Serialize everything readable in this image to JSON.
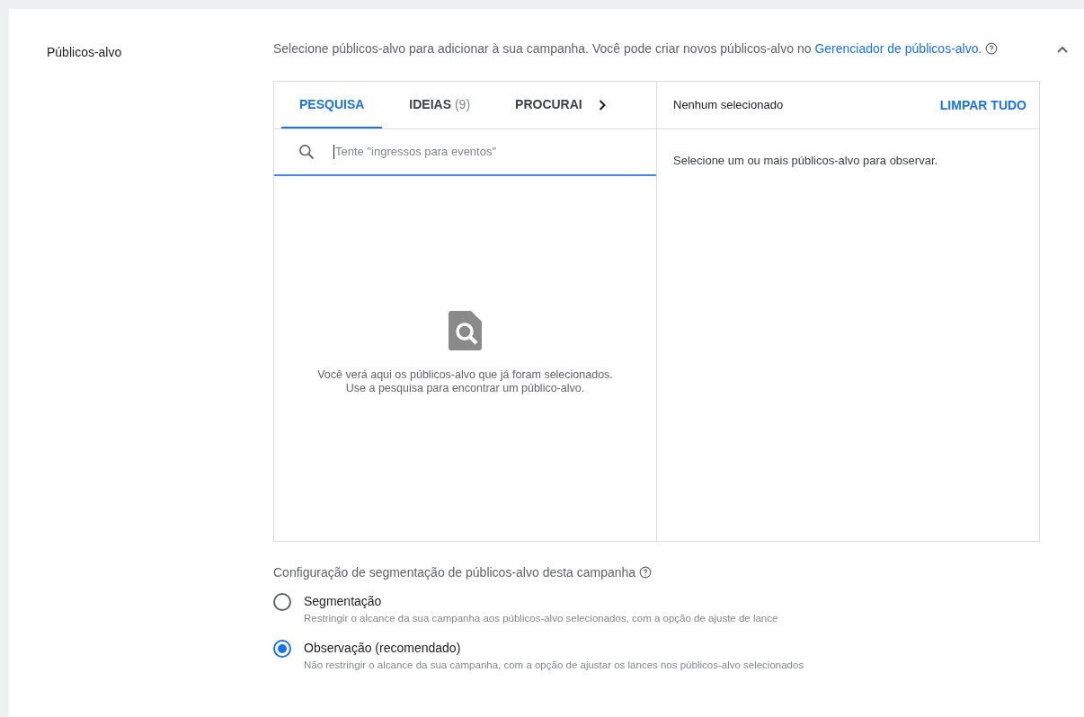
{
  "section": {
    "label": "Públicos-alvo",
    "description": "Selecione públicos-alvo para adicionar à sua campanha. Você pode criar novos públicos-alvo no",
    "link": "Gerenciador de públicos-alvo",
    "link_suffix": ".",
    "expanded": true
  },
  "tabs": [
    {
      "label": "PESQUISA",
      "selected": true
    },
    {
      "label": "IDEIAS",
      "count": "(9)",
      "selected": false
    },
    {
      "label": "PROCURAI",
      "selected": false
    }
  ],
  "search": {
    "placeholder": "Tente \"ingressos para eventos\""
  },
  "empty_state": [
    "Você verá aqui os públicos-alvo que já foram selecionados.",
    "Use a pesquisa para encontrar um público-alvo."
  ],
  "selected_panel": {
    "title": "Nenhum selecionado",
    "clear_button": "LIMPAR TUDO",
    "hint": "Selecione um ou mais públicos-alvo para observar."
  },
  "targeting": {
    "title": "Configuração de segmentação de públicos-alvo desta campanha",
    "options": [
      {
        "label": "Segmentação",
        "description": "Restringir o alcance da sua campanha aos públicos-alvo selecionados, com a opção de ajuste de lance",
        "selected": false
      },
      {
        "label": "Observação (recomendado)",
        "description": "Não restringir o alcance da sua campanha, com a opção de ajustar os lances nos públicos-alvo selecionados",
        "selected": true
      }
    ]
  }
}
